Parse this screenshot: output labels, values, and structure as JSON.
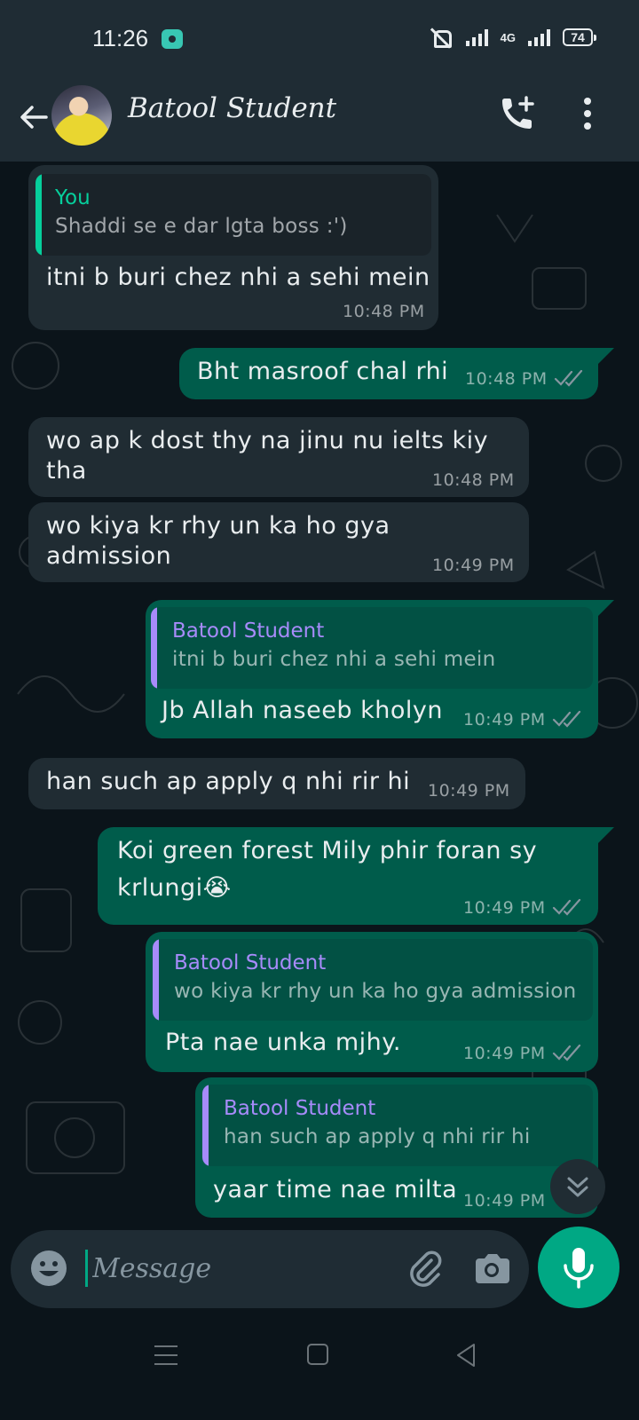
{
  "status_bar": {
    "time": "11:26",
    "network": "4G",
    "battery": "74"
  },
  "header": {
    "contact_name": "Batool Student"
  },
  "messages": [
    {
      "direction": "in",
      "quote_author": "You",
      "quote_text": "Shaddi se e dar lgta boss :')",
      "text": "itni b buri chez nhi a sehi mein",
      "time": "10:48 PM"
    },
    {
      "direction": "out",
      "text": "Bht masroof chal rhi",
      "time": "10:48 PM"
    },
    {
      "direction": "in",
      "text_line1": "wo ap k dost thy na jinu nu ielts kiy",
      "text_line2": "tha",
      "time": "10:48 PM"
    },
    {
      "direction": "in",
      "text_line1": "wo kiya kr rhy un ka ho gya",
      "text_line2": "admission",
      "time": "10:49 PM"
    },
    {
      "direction": "out",
      "quote_author": "Batool Student",
      "quote_text": "itni b buri chez nhi a sehi mein",
      "text": "Jb Allah naseeb kholyn",
      "time": "10:49 PM"
    },
    {
      "direction": "in",
      "text": "han such ap apply q nhi rir hi",
      "time": "10:49 PM"
    },
    {
      "direction": "out",
      "text_line1": "Koi green forest Mily phir foran sy",
      "text_line2": "krlungi😭",
      "time": "10:49 PM"
    },
    {
      "direction": "out",
      "quote_author": "Batool Student",
      "quote_text": "wo kiya kr rhy un ka ho gya admission",
      "text": "Pta nae unka mjhy.",
      "time": "10:49 PM"
    },
    {
      "direction": "out",
      "quote_author": "Batool Student",
      "quote_text": "han such ap apply q nhi rir hi",
      "text": "yaar time nae milta",
      "time": "10:49 PM"
    }
  ],
  "composer": {
    "placeholder": "Message"
  },
  "colors": {
    "incoming_bubble": "#202c33",
    "outgoing_bubble": "#005c4b",
    "accent": "#00a884",
    "quote_you": "#06cf9c",
    "quote_other": "#a78bfa",
    "read_ticks": "#8696a0"
  },
  "icons": [
    "back-arrow-icon",
    "add-call-icon",
    "more-options-icon",
    "double-check-icon",
    "scroll-down-icon",
    "emoji-icon",
    "attach-icon",
    "camera-icon",
    "mic-icon"
  ]
}
